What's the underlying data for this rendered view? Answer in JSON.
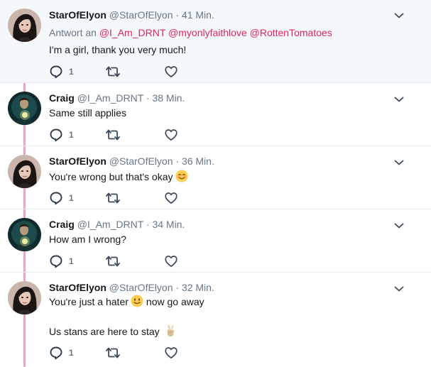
{
  "tweets": [
    {
      "display_name": "StarOfElyon",
      "handle": "@StarOfElyon",
      "time": "· 41 Min.",
      "avatar": "dark-haired-woman-avatar",
      "reply_prefix": "Antwort an",
      "mentions": [
        "@I_Am_DRNT",
        "@myonlyfaithlove",
        "@RottenTomatoes"
      ],
      "text": "I'm a girl, thank you very much!",
      "reply_count": "1"
    },
    {
      "display_name": "Craig",
      "handle": "@I_Am_DRNT",
      "time": "· 38 Min.",
      "avatar": "dark-figure-with-glow-avatar",
      "text": "Same still applies",
      "reply_count": "1"
    },
    {
      "display_name": "StarOfElyon",
      "handle": "@StarOfElyon",
      "time": "· 36 Min.",
      "avatar": "dark-haired-woman-avatar",
      "text": "You're wrong but that's okay",
      "emoji": "smiling-face-emoji",
      "reply_count": "1"
    },
    {
      "display_name": "Craig",
      "handle": "@I_Am_DRNT",
      "time": "· 34 Min.",
      "avatar": "dark-figure-with-glow-avatar",
      "text": "How am I wrong?",
      "reply_count": "1"
    },
    {
      "display_name": "StarOfElyon",
      "handle": "@StarOfElyon",
      "time": "· 32 Min.",
      "avatar": "dark-haired-woman-avatar",
      "text_part1": "You're just a hater",
      "text_part2": "now go away",
      "text_line2": "Us stans are here to stay",
      "emoji1": "slightly-smiling-face-emoji",
      "emoji2": "victory-hand-emoji",
      "reply_count": "1"
    }
  ],
  "icons": {
    "reply": "reply-icon",
    "retweet": "retweet-icon",
    "like": "heart-icon",
    "more": "chevron-down-icon"
  },
  "colors": {
    "thread_line": "#f3a3bd",
    "mention": "#e0245e",
    "meta_text": "#657786",
    "highlight_bg": "#f5f8fa"
  }
}
